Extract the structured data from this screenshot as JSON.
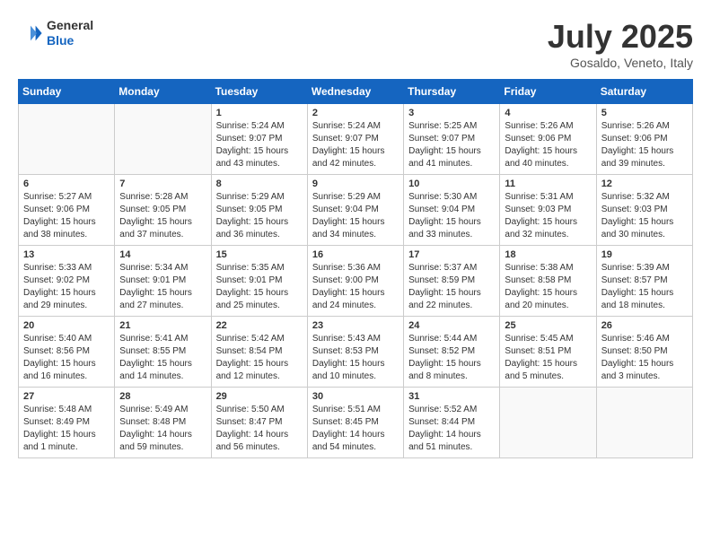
{
  "header": {
    "logo_general": "General",
    "logo_blue": "Blue",
    "month_year": "July 2025",
    "location": "Gosaldo, Veneto, Italy"
  },
  "days_of_week": [
    "Sunday",
    "Monday",
    "Tuesday",
    "Wednesday",
    "Thursday",
    "Friday",
    "Saturday"
  ],
  "weeks": [
    [
      {
        "day": "",
        "content": ""
      },
      {
        "day": "",
        "content": ""
      },
      {
        "day": "1",
        "content": "Sunrise: 5:24 AM\nSunset: 9:07 PM\nDaylight: 15 hours\nand 43 minutes."
      },
      {
        "day": "2",
        "content": "Sunrise: 5:24 AM\nSunset: 9:07 PM\nDaylight: 15 hours\nand 42 minutes."
      },
      {
        "day": "3",
        "content": "Sunrise: 5:25 AM\nSunset: 9:07 PM\nDaylight: 15 hours\nand 41 minutes."
      },
      {
        "day": "4",
        "content": "Sunrise: 5:26 AM\nSunset: 9:06 PM\nDaylight: 15 hours\nand 40 minutes."
      },
      {
        "day": "5",
        "content": "Sunrise: 5:26 AM\nSunset: 9:06 PM\nDaylight: 15 hours\nand 39 minutes."
      }
    ],
    [
      {
        "day": "6",
        "content": "Sunrise: 5:27 AM\nSunset: 9:06 PM\nDaylight: 15 hours\nand 38 minutes."
      },
      {
        "day": "7",
        "content": "Sunrise: 5:28 AM\nSunset: 9:05 PM\nDaylight: 15 hours\nand 37 minutes."
      },
      {
        "day": "8",
        "content": "Sunrise: 5:29 AM\nSunset: 9:05 PM\nDaylight: 15 hours\nand 36 minutes."
      },
      {
        "day": "9",
        "content": "Sunrise: 5:29 AM\nSunset: 9:04 PM\nDaylight: 15 hours\nand 34 minutes."
      },
      {
        "day": "10",
        "content": "Sunrise: 5:30 AM\nSunset: 9:04 PM\nDaylight: 15 hours\nand 33 minutes."
      },
      {
        "day": "11",
        "content": "Sunrise: 5:31 AM\nSunset: 9:03 PM\nDaylight: 15 hours\nand 32 minutes."
      },
      {
        "day": "12",
        "content": "Sunrise: 5:32 AM\nSunset: 9:03 PM\nDaylight: 15 hours\nand 30 minutes."
      }
    ],
    [
      {
        "day": "13",
        "content": "Sunrise: 5:33 AM\nSunset: 9:02 PM\nDaylight: 15 hours\nand 29 minutes."
      },
      {
        "day": "14",
        "content": "Sunrise: 5:34 AM\nSunset: 9:01 PM\nDaylight: 15 hours\nand 27 minutes."
      },
      {
        "day": "15",
        "content": "Sunrise: 5:35 AM\nSunset: 9:01 PM\nDaylight: 15 hours\nand 25 minutes."
      },
      {
        "day": "16",
        "content": "Sunrise: 5:36 AM\nSunset: 9:00 PM\nDaylight: 15 hours\nand 24 minutes."
      },
      {
        "day": "17",
        "content": "Sunrise: 5:37 AM\nSunset: 8:59 PM\nDaylight: 15 hours\nand 22 minutes."
      },
      {
        "day": "18",
        "content": "Sunrise: 5:38 AM\nSunset: 8:58 PM\nDaylight: 15 hours\nand 20 minutes."
      },
      {
        "day": "19",
        "content": "Sunrise: 5:39 AM\nSunset: 8:57 PM\nDaylight: 15 hours\nand 18 minutes."
      }
    ],
    [
      {
        "day": "20",
        "content": "Sunrise: 5:40 AM\nSunset: 8:56 PM\nDaylight: 15 hours\nand 16 minutes."
      },
      {
        "day": "21",
        "content": "Sunrise: 5:41 AM\nSunset: 8:55 PM\nDaylight: 15 hours\nand 14 minutes."
      },
      {
        "day": "22",
        "content": "Sunrise: 5:42 AM\nSunset: 8:54 PM\nDaylight: 15 hours\nand 12 minutes."
      },
      {
        "day": "23",
        "content": "Sunrise: 5:43 AM\nSunset: 8:53 PM\nDaylight: 15 hours\nand 10 minutes."
      },
      {
        "day": "24",
        "content": "Sunrise: 5:44 AM\nSunset: 8:52 PM\nDaylight: 15 hours\nand 8 minutes."
      },
      {
        "day": "25",
        "content": "Sunrise: 5:45 AM\nSunset: 8:51 PM\nDaylight: 15 hours\nand 5 minutes."
      },
      {
        "day": "26",
        "content": "Sunrise: 5:46 AM\nSunset: 8:50 PM\nDaylight: 15 hours\nand 3 minutes."
      }
    ],
    [
      {
        "day": "27",
        "content": "Sunrise: 5:48 AM\nSunset: 8:49 PM\nDaylight: 15 hours\nand 1 minute."
      },
      {
        "day": "28",
        "content": "Sunrise: 5:49 AM\nSunset: 8:48 PM\nDaylight: 14 hours\nand 59 minutes."
      },
      {
        "day": "29",
        "content": "Sunrise: 5:50 AM\nSunset: 8:47 PM\nDaylight: 14 hours\nand 56 minutes."
      },
      {
        "day": "30",
        "content": "Sunrise: 5:51 AM\nSunset: 8:45 PM\nDaylight: 14 hours\nand 54 minutes."
      },
      {
        "day": "31",
        "content": "Sunrise: 5:52 AM\nSunset: 8:44 PM\nDaylight: 14 hours\nand 51 minutes."
      },
      {
        "day": "",
        "content": ""
      },
      {
        "day": "",
        "content": ""
      }
    ]
  ]
}
